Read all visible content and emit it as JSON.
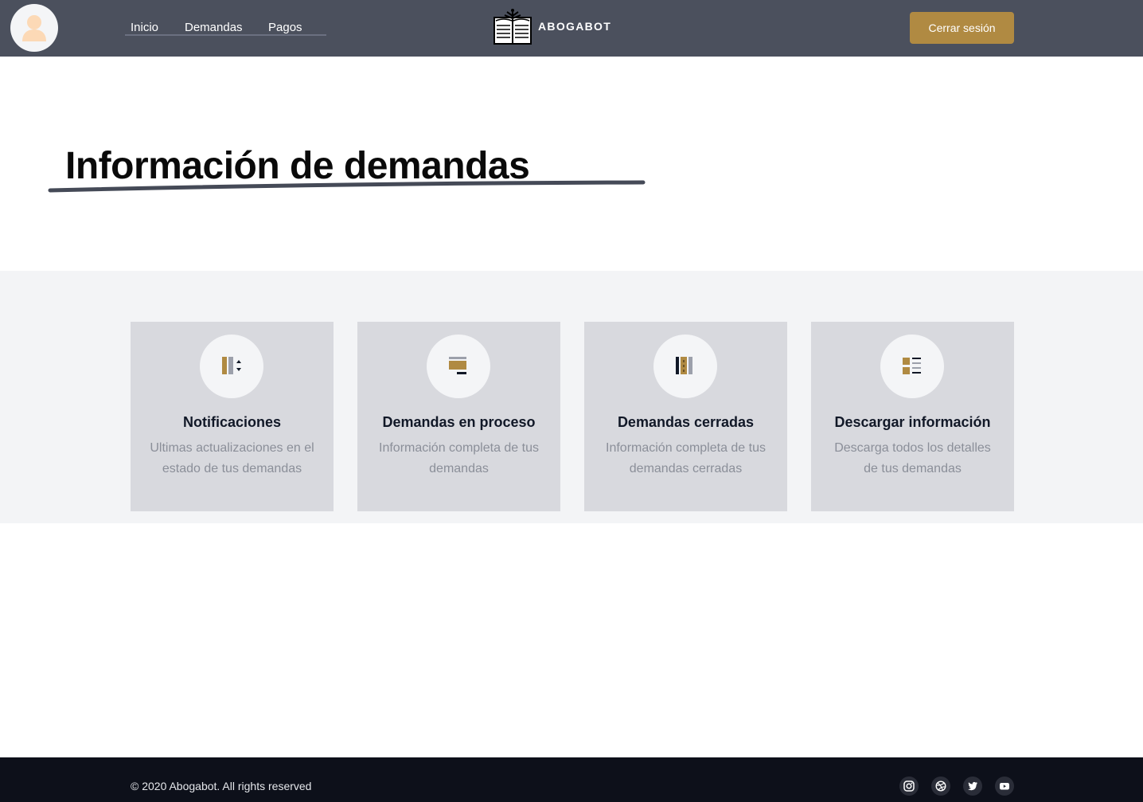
{
  "header": {
    "nav": [
      {
        "label": "Inicio"
      },
      {
        "label": "Demandas"
      },
      {
        "label": "Pagos"
      }
    ],
    "brand": {
      "name": "ABOGABOT",
      "logo_icon": "book-icon"
    },
    "avatar_icon": "user-icon",
    "logout_label": "Cerrar sesión"
  },
  "main": {
    "title": "Información de demandas"
  },
  "cards": [
    {
      "icon": "notifications-icon",
      "title": "Notificaciones",
      "description": "Ultimas actualizaciones en el estado de tus demandas"
    },
    {
      "icon": "in-progress-icon",
      "title": "Demandas en proceso",
      "description": "Información completa de tus demandas"
    },
    {
      "icon": "closed-icon",
      "title": "Demandas cerradas",
      "description": "Información completa de tus demandas cerradas"
    },
    {
      "icon": "download-icon",
      "title": "Descargar información",
      "description": "Descarga todos los detalles de tus demandas"
    }
  ],
  "footer": {
    "copyright": "© 2020 Abogabot. All rights reserved",
    "social": [
      "instagram-icon",
      "dribbble-icon",
      "twitter-icon",
      "youtube-icon"
    ]
  },
  "colors": {
    "header_bg": "#4b505d",
    "accent": "#b08a42",
    "cards_section_bg": "#f3f4f6",
    "card_bg": "#d8d9de",
    "footer_bg": "#0d101a"
  }
}
